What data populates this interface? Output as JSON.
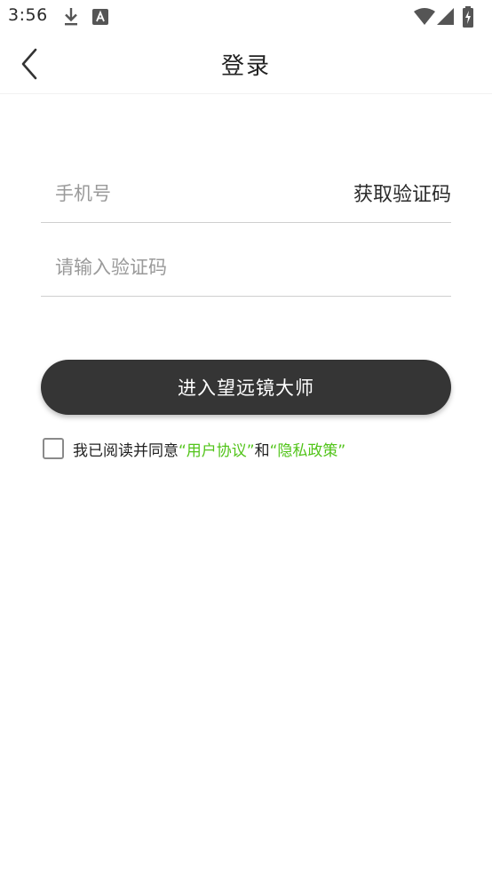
{
  "status_bar": {
    "time": "3:56",
    "icons": [
      "download-icon",
      "a-notification-icon",
      "wifi-icon",
      "signal-icon",
      "battery-charging-icon"
    ]
  },
  "header": {
    "title": "登录",
    "back_icon": "chevron-left-icon"
  },
  "form": {
    "phone_placeholder": "手机号",
    "phone_value": "",
    "get_code_label": "获取验证码",
    "code_placeholder": "请输入验证码",
    "code_value": "",
    "submit_label": "进入望远镜大师"
  },
  "agreement": {
    "checked": false,
    "prefix": "我已阅读并同意",
    "user_agreement": "“用户协议”",
    "conjunction": "和",
    "privacy_policy": "“隐私政策”"
  },
  "colors": {
    "button_bg": "#353535",
    "link": "#52c41a",
    "divider": "#cfcfcf",
    "placeholder": "#9a9a9a"
  }
}
